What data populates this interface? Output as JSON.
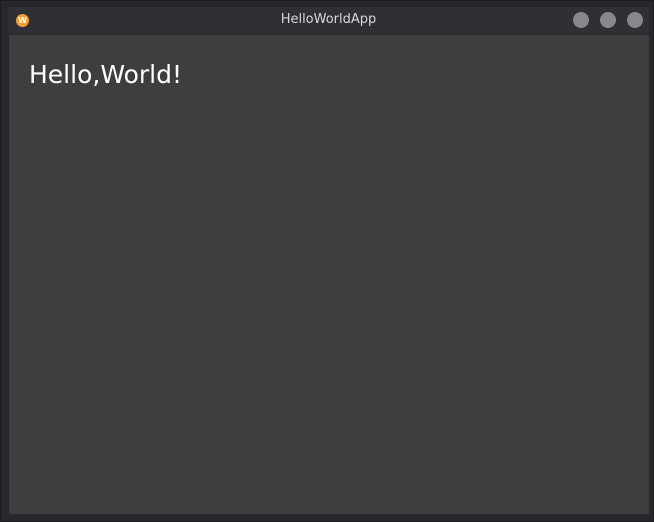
{
  "window": {
    "title": "HelloWorldApp",
    "icon": "app-w-icon",
    "icon_letter": "W",
    "controls": [
      "minimize",
      "maximize",
      "close"
    ]
  },
  "main": {
    "greeting": "Hello,World!"
  },
  "colors": {
    "background": "#3e3e3e",
    "titlebar": "#2f2f36",
    "icon_accent": "#f0a030",
    "control_button": "#87878c",
    "text": "#ffffff"
  }
}
